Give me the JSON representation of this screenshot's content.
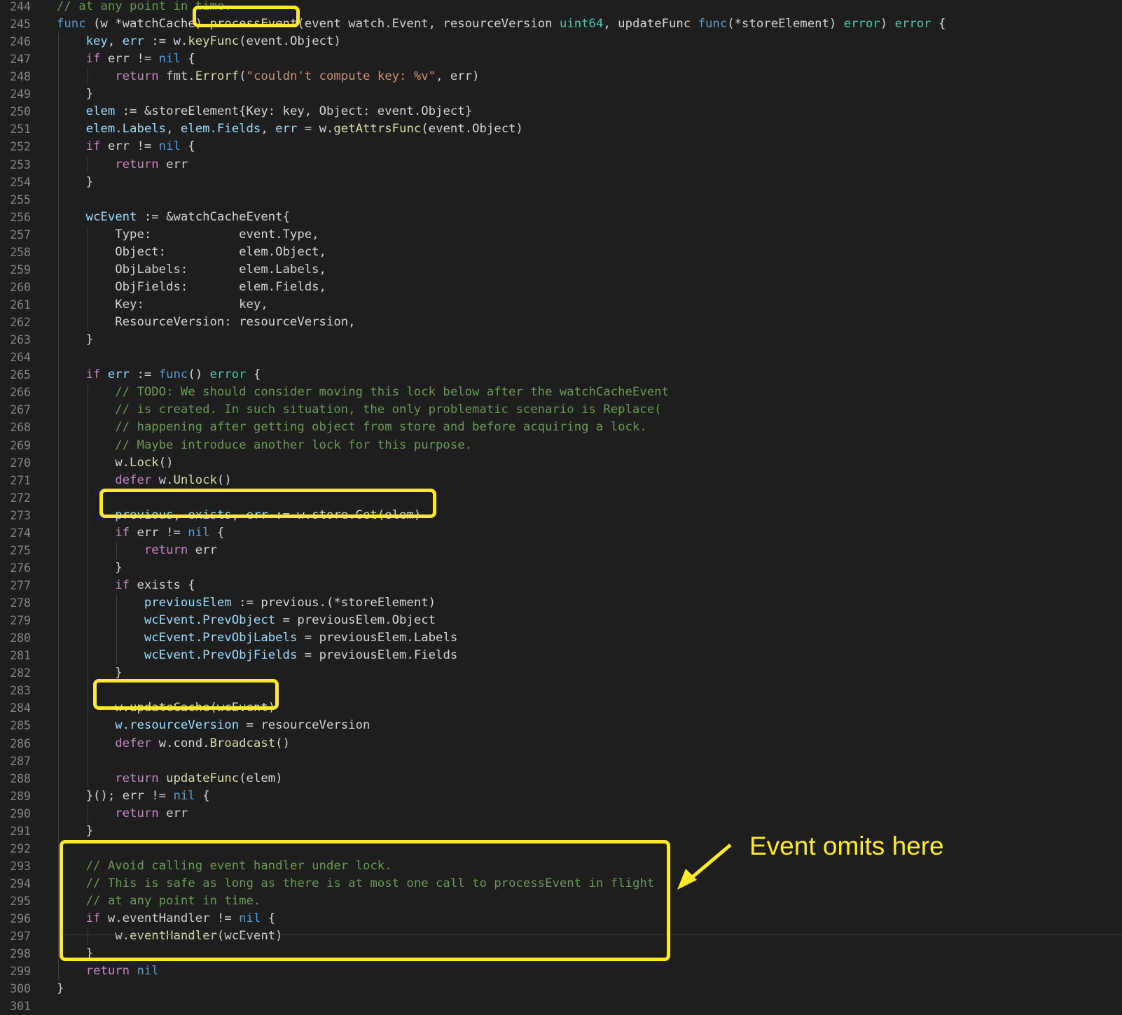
{
  "editor": {
    "lines": [
      {
        "n": "244",
        "tokens": [
          {
            "t": "cmt",
            "v": "// at any point in time."
          }
        ]
      },
      {
        "n": "245",
        "tokens": [
          {
            "t": "kw",
            "v": "func"
          },
          {
            "t": "p",
            "v": " (w *watchCache) "
          },
          {
            "t": "fn",
            "v": "processEvent"
          },
          {
            "t": "p",
            "v": "(event watch.Event, resourceVersion "
          },
          {
            "t": "ty",
            "v": "uint64"
          },
          {
            "t": "p",
            "v": ", updateFunc "
          },
          {
            "t": "kw",
            "v": "func"
          },
          {
            "t": "p",
            "v": "(*storeElement) "
          },
          {
            "t": "ty",
            "v": "error"
          },
          {
            "t": "p",
            "v": ") "
          },
          {
            "t": "ty",
            "v": "error"
          },
          {
            "t": "p",
            "v": " {"
          }
        ]
      },
      {
        "n": "246",
        "tokens": [
          {
            "t": "p",
            "v": "    "
          },
          {
            "t": "var",
            "v": "key"
          },
          {
            "t": "p",
            "v": ", "
          },
          {
            "t": "var",
            "v": "err"
          },
          {
            "t": "p",
            "v": " := w."
          },
          {
            "t": "fn",
            "v": "keyFunc"
          },
          {
            "t": "p",
            "v": "(event.Object)"
          }
        ]
      },
      {
        "n": "247",
        "tokens": [
          {
            "t": "p",
            "v": "    "
          },
          {
            "t": "ctl",
            "v": "if"
          },
          {
            "t": "p",
            "v": " err != "
          },
          {
            "t": "kw",
            "v": "nil"
          },
          {
            "t": "p",
            "v": " {"
          }
        ]
      },
      {
        "n": "248",
        "tokens": [
          {
            "t": "p",
            "v": "        "
          },
          {
            "t": "ctl",
            "v": "return"
          },
          {
            "t": "p",
            "v": " fmt."
          },
          {
            "t": "fn",
            "v": "Errorf"
          },
          {
            "t": "p",
            "v": "("
          },
          {
            "t": "str",
            "v": "\"couldn't compute key: %v\""
          },
          {
            "t": "p",
            "v": ", err)"
          }
        ]
      },
      {
        "n": "249",
        "tokens": [
          {
            "t": "p",
            "v": "    }"
          }
        ]
      },
      {
        "n": "250",
        "tokens": [
          {
            "t": "p",
            "v": "    "
          },
          {
            "t": "var",
            "v": "elem"
          },
          {
            "t": "p",
            "v": " := &storeElement{Key: key, Object: event.Object}"
          }
        ]
      },
      {
        "n": "251",
        "tokens": [
          {
            "t": "p",
            "v": "    "
          },
          {
            "t": "var",
            "v": "elem.Labels"
          },
          {
            "t": "p",
            "v": ", "
          },
          {
            "t": "var",
            "v": "elem.Fields"
          },
          {
            "t": "p",
            "v": ", "
          },
          {
            "t": "var",
            "v": "err"
          },
          {
            "t": "p",
            "v": " = w."
          },
          {
            "t": "fn",
            "v": "getAttrsFunc"
          },
          {
            "t": "p",
            "v": "(event.Object)"
          }
        ]
      },
      {
        "n": "252",
        "tokens": [
          {
            "t": "p",
            "v": "    "
          },
          {
            "t": "ctl",
            "v": "if"
          },
          {
            "t": "p",
            "v": " err != "
          },
          {
            "t": "kw",
            "v": "nil"
          },
          {
            "t": "p",
            "v": " {"
          }
        ]
      },
      {
        "n": "253",
        "tokens": [
          {
            "t": "p",
            "v": "        "
          },
          {
            "t": "ctl",
            "v": "return"
          },
          {
            "t": "p",
            "v": " err"
          }
        ]
      },
      {
        "n": "254",
        "tokens": [
          {
            "t": "p",
            "v": "    }"
          }
        ]
      },
      {
        "n": "255",
        "tokens": []
      },
      {
        "n": "256",
        "tokens": [
          {
            "t": "p",
            "v": "    "
          },
          {
            "t": "var",
            "v": "wcEvent"
          },
          {
            "t": "p",
            "v": " := &watchCacheEvent{"
          }
        ]
      },
      {
        "n": "257",
        "tokens": [
          {
            "t": "p",
            "v": "        Type:            event.Type,"
          }
        ]
      },
      {
        "n": "258",
        "tokens": [
          {
            "t": "p",
            "v": "        Object:          elem.Object,"
          }
        ]
      },
      {
        "n": "259",
        "tokens": [
          {
            "t": "p",
            "v": "        ObjLabels:       elem.Labels,"
          }
        ]
      },
      {
        "n": "260",
        "tokens": [
          {
            "t": "p",
            "v": "        ObjFields:       elem.Fields,"
          }
        ]
      },
      {
        "n": "261",
        "tokens": [
          {
            "t": "p",
            "v": "        Key:             key,"
          }
        ]
      },
      {
        "n": "262",
        "tokens": [
          {
            "t": "p",
            "v": "        ResourceVersion: resourceVersion,"
          }
        ]
      },
      {
        "n": "263",
        "tokens": [
          {
            "t": "p",
            "v": "    }"
          }
        ]
      },
      {
        "n": "264",
        "tokens": []
      },
      {
        "n": "265",
        "tokens": [
          {
            "t": "p",
            "v": "    "
          },
          {
            "t": "ctl",
            "v": "if"
          },
          {
            "t": "p",
            "v": " "
          },
          {
            "t": "var",
            "v": "err"
          },
          {
            "t": "p",
            "v": " := "
          },
          {
            "t": "kw",
            "v": "func"
          },
          {
            "t": "p",
            "v": "() "
          },
          {
            "t": "ty",
            "v": "error"
          },
          {
            "t": "p",
            "v": " {"
          }
        ]
      },
      {
        "n": "266",
        "tokens": [
          {
            "t": "p",
            "v": "        "
          },
          {
            "t": "cmt",
            "v": "// TODO: We should consider moving this lock below after the watchCacheEvent"
          }
        ]
      },
      {
        "n": "267",
        "tokens": [
          {
            "t": "p",
            "v": "        "
          },
          {
            "t": "cmt",
            "v": "// is created. In such situation, the only problematic scenario is Replace("
          }
        ]
      },
      {
        "n": "268",
        "tokens": [
          {
            "t": "p",
            "v": "        "
          },
          {
            "t": "cmt",
            "v": "// happening after getting object from store and before acquiring a lock."
          }
        ]
      },
      {
        "n": "269",
        "tokens": [
          {
            "t": "p",
            "v": "        "
          },
          {
            "t": "cmt",
            "v": "// Maybe introduce another lock for this purpose."
          }
        ]
      },
      {
        "n": "270",
        "tokens": [
          {
            "t": "p",
            "v": "        w."
          },
          {
            "t": "fn",
            "v": "Lock"
          },
          {
            "t": "p",
            "v": "()"
          }
        ]
      },
      {
        "n": "271",
        "tokens": [
          {
            "t": "p",
            "v": "        "
          },
          {
            "t": "ctl",
            "v": "defer"
          },
          {
            "t": "p",
            "v": " w."
          },
          {
            "t": "fn",
            "v": "Unlock"
          },
          {
            "t": "p",
            "v": "()"
          }
        ]
      },
      {
        "n": "272",
        "tokens": []
      },
      {
        "n": "273",
        "tokens": [
          {
            "t": "p",
            "v": "        "
          },
          {
            "t": "var",
            "v": "previous"
          },
          {
            "t": "p",
            "v": ", "
          },
          {
            "t": "var",
            "v": "exists"
          },
          {
            "t": "p",
            "v": ", "
          },
          {
            "t": "var",
            "v": "err"
          },
          {
            "t": "p",
            "v": " := w.store."
          },
          {
            "t": "fn",
            "v": "Get"
          },
          {
            "t": "p",
            "v": "(elem)"
          }
        ]
      },
      {
        "n": "274",
        "tokens": [
          {
            "t": "p",
            "v": "        "
          },
          {
            "t": "ctl",
            "v": "if"
          },
          {
            "t": "p",
            "v": " err != "
          },
          {
            "t": "kw",
            "v": "nil"
          },
          {
            "t": "p",
            "v": " {"
          }
        ]
      },
      {
        "n": "275",
        "tokens": [
          {
            "t": "p",
            "v": "            "
          },
          {
            "t": "ctl",
            "v": "return"
          },
          {
            "t": "p",
            "v": " err"
          }
        ]
      },
      {
        "n": "276",
        "tokens": [
          {
            "t": "p",
            "v": "        }"
          }
        ]
      },
      {
        "n": "277",
        "tokens": [
          {
            "t": "p",
            "v": "        "
          },
          {
            "t": "ctl",
            "v": "if"
          },
          {
            "t": "p",
            "v": " exists {"
          }
        ]
      },
      {
        "n": "278",
        "tokens": [
          {
            "t": "p",
            "v": "            "
          },
          {
            "t": "var",
            "v": "previousElem"
          },
          {
            "t": "p",
            "v": " := previous.(*storeElement)"
          }
        ]
      },
      {
        "n": "279",
        "tokens": [
          {
            "t": "p",
            "v": "            "
          },
          {
            "t": "var",
            "v": "wcEvent.PrevObject"
          },
          {
            "t": "p",
            "v": " = previousElem.Object"
          }
        ]
      },
      {
        "n": "280",
        "tokens": [
          {
            "t": "p",
            "v": "            "
          },
          {
            "t": "var",
            "v": "wcEvent.PrevObjLabels"
          },
          {
            "t": "p",
            "v": " = previousElem.Labels"
          }
        ]
      },
      {
        "n": "281",
        "tokens": [
          {
            "t": "p",
            "v": "            "
          },
          {
            "t": "var",
            "v": "wcEvent.PrevObjFields"
          },
          {
            "t": "p",
            "v": " = previousElem.Fields"
          }
        ]
      },
      {
        "n": "282",
        "tokens": [
          {
            "t": "p",
            "v": "        }"
          }
        ]
      },
      {
        "n": "283",
        "tokens": []
      },
      {
        "n": "284",
        "tokens": [
          {
            "t": "p",
            "v": "        w."
          },
          {
            "t": "fn",
            "v": "updateCache"
          },
          {
            "t": "p",
            "v": "(wcEvent)"
          }
        ]
      },
      {
        "n": "285",
        "tokens": [
          {
            "t": "p",
            "v": "        "
          },
          {
            "t": "var",
            "v": "w.resourceVersion"
          },
          {
            "t": "p",
            "v": " = resourceVersion"
          }
        ]
      },
      {
        "n": "286",
        "tokens": [
          {
            "t": "p",
            "v": "        "
          },
          {
            "t": "ctl",
            "v": "defer"
          },
          {
            "t": "p",
            "v": " w.cond."
          },
          {
            "t": "fn",
            "v": "Broadcast"
          },
          {
            "t": "p",
            "v": "()"
          }
        ]
      },
      {
        "n": "287",
        "tokens": []
      },
      {
        "n": "288",
        "tokens": [
          {
            "t": "p",
            "v": "        "
          },
          {
            "t": "ctl",
            "v": "return"
          },
          {
            "t": "p",
            "v": " "
          },
          {
            "t": "fn",
            "v": "updateFunc"
          },
          {
            "t": "p",
            "v": "(elem)"
          }
        ]
      },
      {
        "n": "289",
        "tokens": [
          {
            "t": "p",
            "v": "    }(); err != "
          },
          {
            "t": "kw",
            "v": "nil"
          },
          {
            "t": "p",
            "v": " {"
          }
        ]
      },
      {
        "n": "290",
        "tokens": [
          {
            "t": "p",
            "v": "        "
          },
          {
            "t": "ctl",
            "v": "return"
          },
          {
            "t": "p",
            "v": " err"
          }
        ]
      },
      {
        "n": "291",
        "tokens": [
          {
            "t": "p",
            "v": "    }"
          }
        ]
      },
      {
        "n": "292",
        "tokens": []
      },
      {
        "n": "293",
        "tokens": [
          {
            "t": "p",
            "v": "    "
          },
          {
            "t": "cmt",
            "v": "// Avoid calling event handler under lock."
          }
        ]
      },
      {
        "n": "294",
        "tokens": [
          {
            "t": "p",
            "v": "    "
          },
          {
            "t": "cmt",
            "v": "// This is safe as long as there is at most one call to processEvent in flight"
          }
        ]
      },
      {
        "n": "295",
        "tokens": [
          {
            "t": "p",
            "v": "    "
          },
          {
            "t": "cmt",
            "v": "// at any point in time."
          }
        ]
      },
      {
        "n": "296",
        "tokens": [
          {
            "t": "p",
            "v": "    "
          },
          {
            "t": "ctl",
            "v": "if"
          },
          {
            "t": "p",
            "v": " w.eventHandler != "
          },
          {
            "t": "kw",
            "v": "nil"
          },
          {
            "t": "p",
            "v": " {"
          }
        ]
      },
      {
        "n": "297",
        "tokens": [
          {
            "t": "p",
            "v": "        w."
          },
          {
            "t": "fn",
            "v": "eventHandler"
          },
          {
            "t": "p",
            "v": "(wcEvent)"
          }
        ]
      },
      {
        "n": "298",
        "tokens": [
          {
            "t": "p",
            "v": "    }"
          }
        ]
      },
      {
        "n": "299",
        "tokens": [
          {
            "t": "p",
            "v": "    "
          },
          {
            "t": "ctl",
            "v": "return"
          },
          {
            "t": "p",
            "v": " "
          },
          {
            "t": "kw",
            "v": "nil"
          }
        ]
      },
      {
        "n": "300",
        "tokens": [
          {
            "t": "p",
            "v": "}"
          }
        ]
      },
      {
        "n": "301",
        "tokens": []
      }
    ]
  },
  "annotations": {
    "note": "Event omits here",
    "highlight_color": "#ffea2a"
  },
  "theme": {
    "background": "#1e1e1e",
    "line_number": "#858585",
    "keyword": "#569cd6",
    "control": "#c586c0",
    "variable": "#9cdcfe",
    "function": "#dcdcaa",
    "type": "#4ec9b0",
    "string": "#ce9178",
    "comment": "#6a9955",
    "text": "#d4d4d4"
  }
}
